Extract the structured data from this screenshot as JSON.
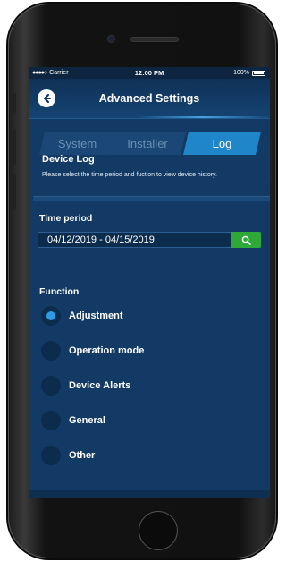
{
  "status": {
    "carrier": "Carrier",
    "time": "12:00 PM",
    "battery": "100%"
  },
  "nav": {
    "title": "Advanced Settings",
    "back_icon": "back-arrow-icon"
  },
  "tabs": [
    {
      "label": "System",
      "active": false
    },
    {
      "label": "Installer",
      "active": false
    },
    {
      "label": "Log",
      "active": true
    }
  ],
  "section": {
    "title": "Device Log",
    "description": "Please select the time period and fuction to view device history."
  },
  "time_period": {
    "label": "Time period",
    "value": "04/12/2019 - 04/15/2019",
    "search_icon": "search-icon"
  },
  "function": {
    "label": "Function",
    "options": [
      {
        "label": "Adjustment",
        "selected": true
      },
      {
        "label": "Operation mode",
        "selected": false
      },
      {
        "label": "Device Alerts",
        "selected": false
      },
      {
        "label": "General",
        "selected": false
      },
      {
        "label": "Other",
        "selected": false
      }
    ]
  },
  "colors": {
    "background": "#123a64",
    "accent": "#1f86c9",
    "search_button": "#2fa83a",
    "radio_selected": "#2d9be6"
  }
}
